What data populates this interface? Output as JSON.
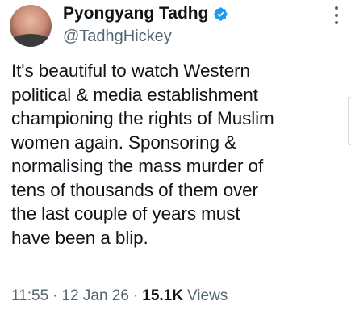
{
  "author": {
    "display_name": "Pyongyang Tadhg",
    "handle": "@TadhgHickey",
    "verified_icon": "verified-badge-icon"
  },
  "tweet": {
    "text": "It's beautiful to watch Western\npolitical & media establishment\nchampioning the rights of Muslim\nwomen again. Sponsoring &\nnormalising the mass murder of\ntens of thousands of them over\nthe last couple of years must\nhave been a blip."
  },
  "meta": {
    "time": "11:55",
    "separator": "·",
    "date": "12 Jan 26",
    "views_count": "15.1K",
    "views_label": "Views"
  },
  "colors": {
    "text_primary": "#0f1419",
    "text_secondary": "#536471",
    "verified_blue": "#1d9bf0"
  }
}
